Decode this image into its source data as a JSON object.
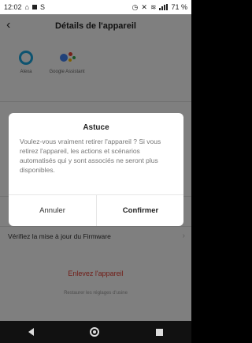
{
  "status_bar": {
    "time": "12:02",
    "carrier_icon": "S",
    "battery": "71 %"
  },
  "header": {
    "title": "Détails de l'appareil"
  },
  "assistants": [
    {
      "label": "Alexa"
    },
    {
      "label": "Google Assistant"
    }
  ],
  "list": {
    "firmware_label": "Vérifiez la mise à jour du Firmware"
  },
  "actions": {
    "remove_label": "Enlevez l'appareil",
    "restore_label": "Restaurer les réglages d'usine"
  },
  "dialog": {
    "title": "Astuce",
    "message": "Voulez-vous vraiment retirer l'appareil ? Si vous retirez l'appareil, les actions et scénarios automatisés qui y sont associés ne seront plus disponibles.",
    "cancel_label": "Annuler",
    "confirm_label": "Confirmer"
  },
  "colors": {
    "accent_red": "#e03a2e",
    "alexa_blue": "#1aa7e0"
  }
}
